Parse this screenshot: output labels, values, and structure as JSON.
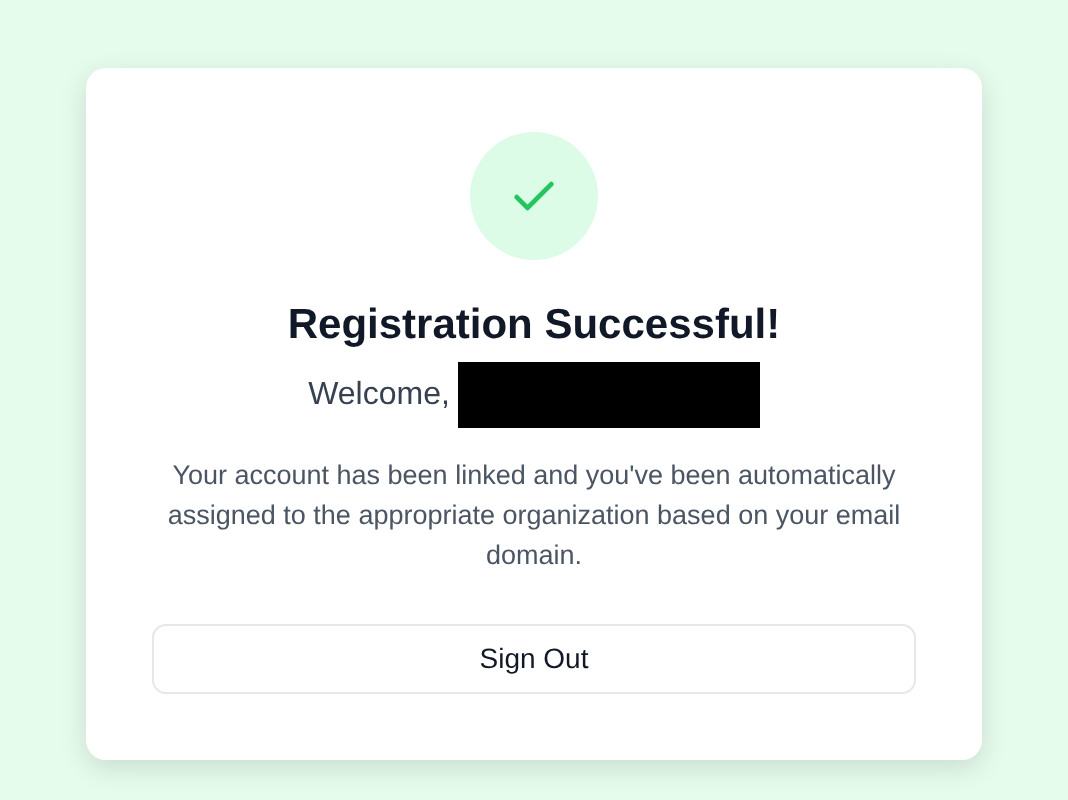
{
  "card": {
    "title": "Registration Successful!",
    "welcome": "Welcome,",
    "name_redacted": true,
    "message": "Your account has been linked and you've been automatically assigned to the appropriate organization based on your email domain.",
    "button": "Sign Out"
  }
}
